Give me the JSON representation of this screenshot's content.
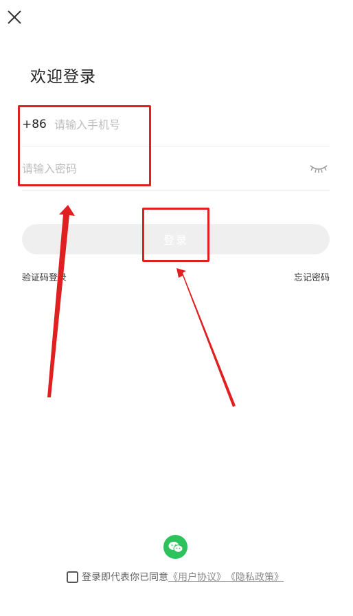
{
  "header": {
    "close_icon": "close-icon",
    "title": "欢迎登录"
  },
  "form": {
    "country_code": "+86",
    "phone_placeholder": "请输入手机号",
    "password_placeholder": "请输入密码",
    "eye_icon": "eye-closed-icon"
  },
  "actions": {
    "login_label": "登录",
    "sms_login_label": "验证码登录",
    "forgot_password_label": "忘记密码"
  },
  "footer": {
    "wechat_icon": "wechat-icon",
    "agreement_text": "登录即代表你已同意",
    "user_agreement": "《用户协议》",
    "privacy_policy": "《隐私政策》"
  },
  "colors": {
    "annotation": "#e02020",
    "wechat_green": "#2dc25b",
    "login_button_bg": "#efefef"
  }
}
